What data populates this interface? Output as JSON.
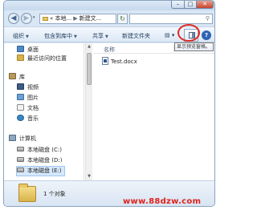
{
  "window": {
    "minimize_symbol": "–",
    "maximize_symbol": "□",
    "close_symbol": "✕"
  },
  "address_bar": {
    "back_symbol": "◀",
    "forward_symbol": "▶",
    "history_symbol": "▾",
    "prefix": "«",
    "crumbs": [
      "本地...",
      "新建文..."
    ],
    "separator": "▶",
    "refresh_symbol": "↻",
    "search_symbol": "⚲"
  },
  "toolbar": {
    "organize": "组织",
    "include_in_library": "包含到库中",
    "share": "共享",
    "new_folder": "新建文件夹",
    "view_symbol": "▤ ▾",
    "preview_pane_tooltip": "显示预览窗格。",
    "help_symbol": "?"
  },
  "nav_pane": {
    "favorites": [
      {
        "label": "桌面",
        "icon": "desktop-icon"
      },
      {
        "label": "最近访问的位置",
        "icon": "recent-places-icon"
      }
    ],
    "libraries_label": "库",
    "libraries": [
      {
        "label": "视频",
        "icon": "video-library-icon"
      },
      {
        "label": "图片",
        "icon": "pictures-library-icon"
      },
      {
        "label": "文档",
        "icon": "documents-library-icon"
      },
      {
        "label": "音乐",
        "icon": "music-library-icon"
      }
    ],
    "computer_label": "计算机",
    "drives": [
      {
        "label": "本地磁盘 (C:)",
        "icon": "disk-drive-icon"
      },
      {
        "label": "本地磁盘 (D:)",
        "icon": "disk-drive-icon"
      },
      {
        "label": "本地磁盘 (E:)",
        "icon": "disk-drive-icon",
        "selected": true
      }
    ]
  },
  "file_list": {
    "column_name": "名称",
    "files": [
      {
        "name": "Test.docx",
        "icon": "word-document-icon"
      }
    ]
  },
  "details_pane": {
    "item_count": "1 个对象"
  },
  "watermark": {
    "text": "www.88dzw.com"
  }
}
